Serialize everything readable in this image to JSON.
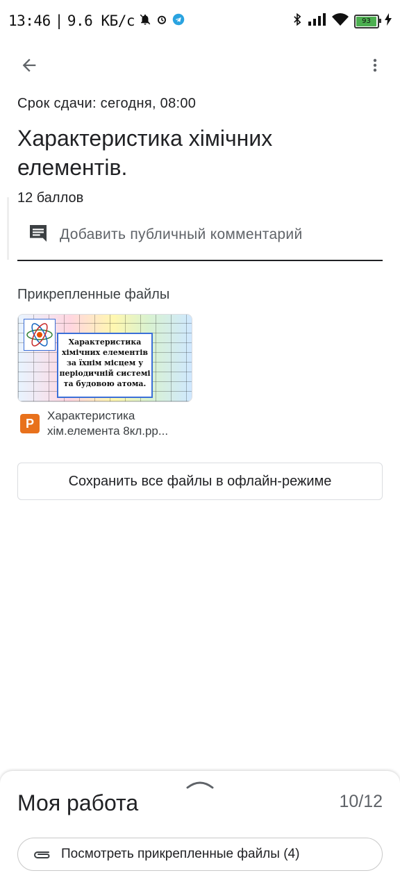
{
  "status_bar": {
    "time": "13:46",
    "separator": "|",
    "speed": "9.6 КБ/с",
    "battery_level": "93",
    "icons": [
      "bell-off-icon",
      "alarm-icon",
      "telegram-icon",
      "bluetooth-icon",
      "signal-icon",
      "wifi-icon",
      "battery-icon",
      "charging-icon"
    ]
  },
  "toolbar": {
    "back_icon": "arrow-back-icon",
    "more_icon": "more-vert-icon"
  },
  "assignment": {
    "due": "Срок сдачи: сегодня, 08:00",
    "title": "Характеристика хімічних елементів.",
    "points": "12 баллов",
    "comment_placeholder": "Добавить публичный комментарий"
  },
  "attachments": {
    "heading": "Прикрепленные файлы",
    "thumbnail_caption": "Характеристика хімічних елементів за їхнім місцем у періодичній системі та будовою атома.",
    "file_type_badge": "P",
    "file_name_line1": "Характеристика",
    "file_name_line2": "хім.елемента 8кл.pp...",
    "save_offline_label": "Сохранить все файлы в офлайн-режиме"
  },
  "my_work": {
    "title": "Моя работа",
    "score": "10/12",
    "view_files_label": "Посмотреть прикрепленные файлы (4)"
  },
  "colors": {
    "accent_orange": "#e8711c",
    "battery_green": "#4caf50",
    "text_primary": "#202124",
    "text_secondary": "#5f6368"
  }
}
